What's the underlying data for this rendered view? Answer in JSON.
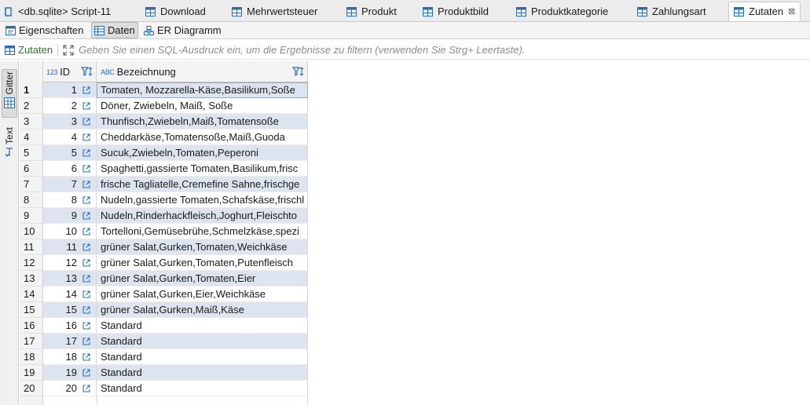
{
  "editor_tabs": [
    {
      "label": "<db.sqlite> Script-11",
      "icon": "script-icon",
      "active": false
    },
    {
      "label": "Download",
      "icon": "table-icon",
      "active": false
    },
    {
      "label": "Mehrwertsteuer",
      "icon": "table-icon",
      "active": false
    },
    {
      "label": "Produkt",
      "icon": "table-icon",
      "active": false
    },
    {
      "label": "Produktbild",
      "icon": "table-icon",
      "active": false
    },
    {
      "label": "Produktkategorie",
      "icon": "table-icon",
      "active": false
    },
    {
      "label": "Zahlungsart",
      "icon": "table-icon",
      "active": false
    },
    {
      "label": "Zutaten",
      "icon": "table-icon",
      "active": true,
      "close": "⊠"
    }
  ],
  "sub_tabs": [
    {
      "label": "Eigenschaften",
      "icon": "properties-icon",
      "active": false
    },
    {
      "label": "Daten",
      "icon": "data-grid-icon",
      "active": true
    },
    {
      "label": "ER Diagramm",
      "icon": "er-diagram-icon",
      "active": false
    }
  ],
  "filter": {
    "table_name": "Zutaten",
    "placeholder": "Geben Sie einen SQL-Ausdruck ein, um die Ergebnisse zu filtern (verwenden Sie Strg+ Leertaste)."
  },
  "side_panel": {
    "tabs": [
      {
        "label": "Gitter",
        "icon": "grid-view-icon",
        "active": true
      },
      {
        "label": "Text",
        "icon": "text-view-icon",
        "active": false
      }
    ]
  },
  "grid": {
    "columns": [
      {
        "type": "123",
        "label": "ID"
      },
      {
        "type": "ABC",
        "label": "Bezeichnung"
      }
    ],
    "rows": [
      {
        "num": "1",
        "id": "1",
        "bezeichnung": "Tomaten, Mozzarella-Käse,Basilikum,Soße"
      },
      {
        "num": "2",
        "id": "2",
        "bezeichnung": "Döner, Zwiebeln, Maiß, Soße"
      },
      {
        "num": "3",
        "id": "3",
        "bezeichnung": "Thunfisch,Zwiebeln,Maiß,Tomatensoße"
      },
      {
        "num": "4",
        "id": "4",
        "bezeichnung": "Cheddarkäse,Tomatensoße,Maiß,Guoda"
      },
      {
        "num": "5",
        "id": "5",
        "bezeichnung": "Sucuk,Zwiebeln,Tomaten,Peperoni"
      },
      {
        "num": "6",
        "id": "6",
        "bezeichnung": "Spaghetti,gassierte Tomaten,Basilikum,frisc"
      },
      {
        "num": "7",
        "id": "7",
        "bezeichnung": "frische Tagliatelle,Cremefine Sahne,frischge"
      },
      {
        "num": "8",
        "id": "8",
        "bezeichnung": "Nudeln,gassierte Tomaten,Schafskäse,frischl"
      },
      {
        "num": "9",
        "id": "9",
        "bezeichnung": "Nudeln,Rinderhackfleisch,Joghurt,Fleischto"
      },
      {
        "num": "10",
        "id": "10",
        "bezeichnung": "Tortelloni,Gemüsebrühe,Schmelzkäse,spezi"
      },
      {
        "num": "11",
        "id": "11",
        "bezeichnung": "grüner Salat,Gurken,Tomaten,Weichkäse"
      },
      {
        "num": "12",
        "id": "12",
        "bezeichnung": "grüner Salat,Gurken,Tomaten,Putenfleisch"
      },
      {
        "num": "13",
        "id": "13",
        "bezeichnung": "grüner Salat,Gurken,Tomaten,Eier"
      },
      {
        "num": "14",
        "id": "14",
        "bezeichnung": "grüner Salat,Gurken,Eier,Weichkäse"
      },
      {
        "num": "15",
        "id": "15",
        "bezeichnung": "grüner Salat,Gurken,Maiß,Käse"
      },
      {
        "num": "16",
        "id": "16",
        "bezeichnung": "Standard"
      },
      {
        "num": "17",
        "id": "17",
        "bezeichnung": "Standard"
      },
      {
        "num": "18",
        "id": "18",
        "bezeichnung": "Standard"
      },
      {
        "num": "19",
        "id": "19",
        "bezeichnung": "Standard"
      },
      {
        "num": "20",
        "id": "20",
        "bezeichnung": "Standard"
      }
    ]
  },
  "colors": {
    "row_alt": "#dce4ef",
    "accent": "#2a6ebb",
    "filter_green": "#2f7d20"
  }
}
